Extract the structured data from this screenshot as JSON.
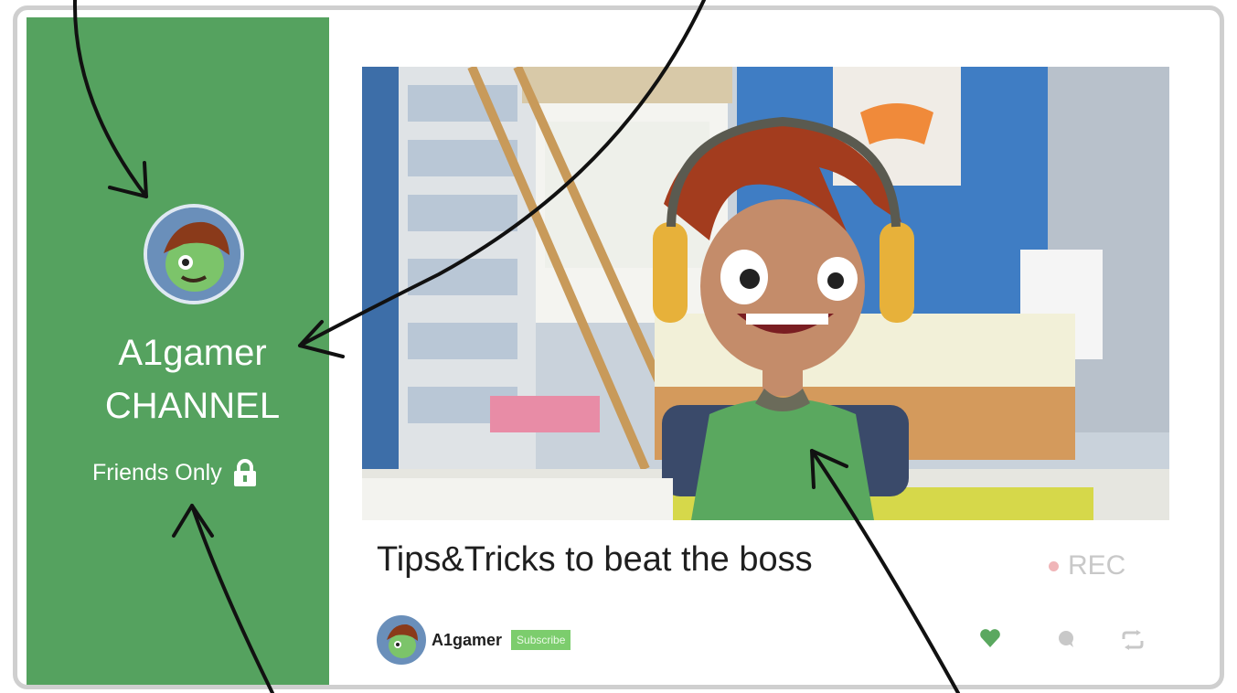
{
  "sidebar": {
    "channel_line1": "A1gamer",
    "channel_line2": "CHANNEL",
    "privacy_label": "Friends Only",
    "privacy_icon": "lock-icon"
  },
  "video": {
    "title": "Tips&Tricks to beat the boss",
    "rec_label": "REC",
    "author": "A1gamer",
    "subscribe_label": "Subscribe",
    "actions": [
      "heart-icon",
      "comment-icon",
      "share-icon"
    ]
  },
  "colors": {
    "sidebar_green": "#55a25f",
    "subscribe_green": "#7ccd6d",
    "heart_green": "#5aa85f",
    "rec_dot": "#f0b5b8",
    "frame_border": "#cfcfcf"
  }
}
